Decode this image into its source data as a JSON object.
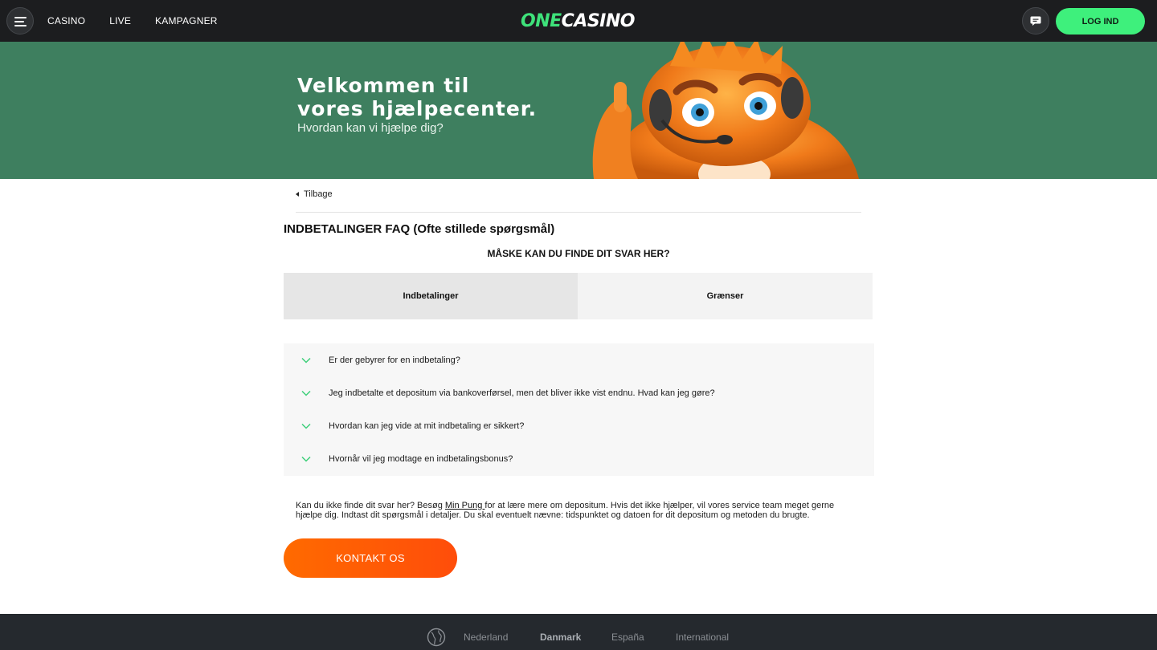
{
  "header": {
    "nav": [
      "CASINO",
      "LIVE",
      "KAMPAGNER"
    ],
    "logo_one": "ONE",
    "logo_casino": "CASINO",
    "login_label": "LOG IND"
  },
  "hero": {
    "title": "Velkommen til vores hjælpecenter.",
    "subtitle": "Hvordan kan vi hjælpe dig?"
  },
  "content": {
    "back_label": "Tilbage",
    "title": "INDBETALINGER FAQ (Ofte stillede spørgsmål)",
    "subtitle": "MÅSKE KAN DU FINDE DIT SVAR HER?",
    "tabs": [
      {
        "label": "Indbetalinger",
        "active": true
      },
      {
        "label": "Grænser",
        "active": false
      }
    ],
    "faq": [
      "Er der gebyrer for en indbetaling?",
      "Jeg indbetalte et depositum via bankoverførsel, men det bliver ikke vist endnu. Hvad kan jeg gøre?",
      "Hvordan kan jeg vide at mit indbetaling er sikkert?",
      "Hvornår vil jeg modtage en indbetalingsbonus?"
    ],
    "help_before": "Kan du ikke finde dit svar her? Besøg ",
    "help_link": "Min Pung ",
    "help_after": "for at lære mere om depositum. Hvis det ikke hjælper, vil vores service team meget gerne hjælpe dig. Indtast dit spørgsmål i detaljer. Du skal eventuelt nævne: tidspunktet og datoen for dit depositum og metoden du brugte.",
    "contact_label": "KONTAKT OS"
  },
  "footer": {
    "languages": [
      {
        "label": "Nederland",
        "active": false
      },
      {
        "label": "Danmark",
        "active": true
      },
      {
        "label": "España",
        "active": false
      },
      {
        "label": "International",
        "active": false
      }
    ]
  },
  "colors": {
    "topbar": "#1c1d1f",
    "brand_green": "#3ef07c",
    "hero_green": "#3e7f5f",
    "cta_orange": "#ff5a05",
    "footer": "#25292e"
  },
  "icons": {
    "menu": "hamburger-icon",
    "chat": "chat-bubble-icon",
    "back": "triangle-left-icon",
    "faq_toggle": "chevron-down-icon",
    "footer_lang": "globe-icon"
  }
}
